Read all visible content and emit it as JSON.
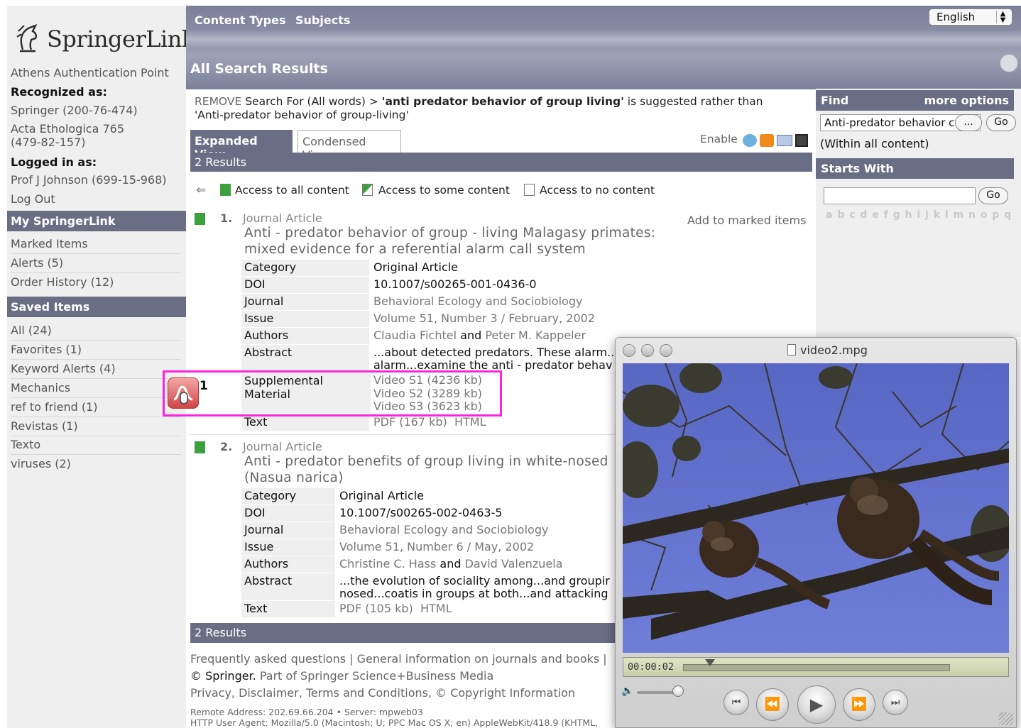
{
  "brand": {
    "name": "SpringerLink"
  },
  "sidebar": {
    "auth_point": "Athens Authentication Point",
    "recognized_label": "Recognized as:",
    "recognized": [
      "Springer (200-76-474)",
      "Acta Ethologica 765",
      "(479-82-157)"
    ],
    "logged_in_label": "Logged in as:",
    "user": "Prof J Johnson (699-15-968)",
    "logout": "Log Out",
    "my_springerlink": {
      "header": "My SpringerLink",
      "items": [
        "Marked Items",
        "Alerts (5)",
        "Order History (12)"
      ]
    },
    "saved_items": {
      "header": "Saved Items",
      "items": [
        "All (24)",
        "Favorites (1)",
        "Keyword Alerts (4)",
        "Mechanics",
        "ref to friend (1)",
        "Revistas (1)",
        "Texto",
        "viruses (2)"
      ]
    }
  },
  "header": {
    "nav": [
      "Content Types",
      "Subjects"
    ],
    "language": "English",
    "page_title": "All Search Results"
  },
  "search_summary": {
    "remove": "REMOVE",
    "prefix": " Search For (All words) > ",
    "query": "'anti predator behavior of group living'",
    "suffix_line1": " is suggested rather than",
    "line2": "'Anti-predator behavior of group-living'"
  },
  "tabs": {
    "expanded": "Expanded View",
    "condensed": "Condensed View"
  },
  "enable_label": "Enable",
  "results_count": "2 Results",
  "access_legend": {
    "all": "Access to all content",
    "some": "Access to some content",
    "none": "Access to no content"
  },
  "add_marked": "Add to marked items",
  "results": [
    {
      "num": "1.",
      "type": "Journal Article",
      "title_line1": "Anti - predator  behavior  of  group - living  Malagasy  primates:",
      "title_line2": "mixed evidence for a referential alarm call system",
      "labels": {
        "category": "Category",
        "doi": "DOI",
        "journal": "Journal",
        "issue": "Issue",
        "authors": "Authors",
        "abstract": "Abstract",
        "supplemental": "Supplemental Material",
        "text": "Text"
      },
      "category": "Original Article",
      "doi": "10.1007/s00265-001-0436-0",
      "journal": "Behavioral Ecology and Sociobiology",
      "issue": "Volume 51, Number 3 / February, 2002",
      "author1": "Claudia Fichtel",
      "and": " and ",
      "author2": "Peter M. Kappeler",
      "abstract_line1": "...about detected predators. These alarm...",
      "abstract_line2": "alarm...examine the  anti - predator  behav",
      "supplemental": [
        "Video S1 (4236 kb)",
        "Video S2 (3289 kb)",
        "Video S3 (3623 kb)"
      ],
      "text_pdf": "PDF (167 kb)",
      "text_html": "HTML"
    },
    {
      "num": "2.",
      "type": "Journal Article",
      "title_line1": "Anti - predator  benefits  of  group  living  in white-nosed",
      "title_line2": "(Nasua narica)",
      "labels": {
        "category": "Category",
        "doi": "DOI",
        "journal": "Journal",
        "issue": "Issue",
        "authors": "Authors",
        "abstract": "Abstract",
        "text": "Text"
      },
      "category": "Original Article",
      "doi": "10.1007/s00265-002-0463-5",
      "journal": "Behavioral Ecology and Sociobiology",
      "issue": "Volume 51, Number 6 / May, 2002",
      "author1": "Christine C. Hass",
      "and": " and ",
      "author2": "David Valenzuela",
      "abstract_line1": "...the evolution  of  sociality among...and groupir",
      "abstract_line2": "nosed...coatis in groups at both...and attacking",
      "text_pdf": "PDF (105 kb)",
      "text_html": "HTML"
    }
  ],
  "annotation": {
    "number": "1"
  },
  "right_panel": {
    "find_label": "Find",
    "more_options": "more options",
    "find_value": "Anti-predator behavior c",
    "ellipsis_button": "...",
    "go_button": "Go",
    "within": "(Within all content)",
    "starts_with": "Starts With",
    "starts_go": "Go",
    "alphabet": "a b c d e f g h i  j  k l  m n o p q"
  },
  "footer": {
    "faq": "Frequently asked questions",
    "sep": " | ",
    "general": "General information on journals and books",
    "sep2": " |",
    "copyright_springer": "© Springer.",
    "copyright_rest": " Part of Springer Science+Business Media",
    "legal": "Privacy, Disclaimer, Terms and Conditions, © Copyright Information",
    "remote": "Remote Address: 202.69.66.204 • Server: mpweb03",
    "agent": "HTTP User Agent: Mozilla/5.0 (Macintosh; U; PPC Mac OS X; en) AppleWebKit/418.9 (KHTML,"
  },
  "video_window": {
    "title": "video2.mpg",
    "timecode": "00:00:02",
    "playhead_fraction": 0.1
  }
}
